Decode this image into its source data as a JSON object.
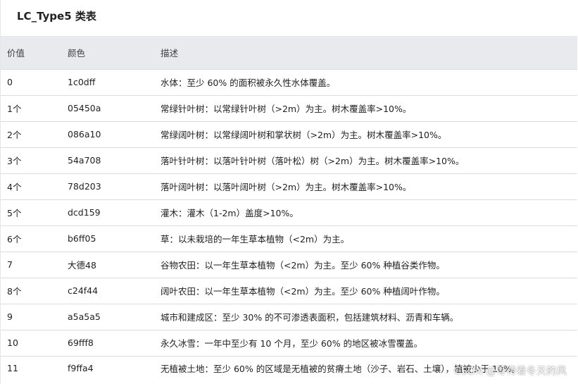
{
  "title": "LC_Type5 类表",
  "headers": [
    "价值",
    "颜色",
    "描述"
  ],
  "rows": [
    [
      "0",
      "1c0dff",
      "水体：至少 60% 的面积被永久性水体覆盖。"
    ],
    [
      "1个",
      "05450a",
      "常绿针叶树：以常绿针叶树（>2m）为主。树木覆盖率>10%。"
    ],
    [
      "2个",
      "086a10",
      "常绿阔叶树：以常绿阔叶树和掌状树（>2m）为主。树木覆盖率>10%。"
    ],
    [
      "3个",
      "54a708",
      "落叶针叶树：以落叶针叶树（落叶松）树（>2m）为主。树木覆盖率>10%。"
    ],
    [
      "4个",
      "78d203",
      "落叶阔叶树：以落叶阔叶树（>2m）为主。树木覆盖率>10%。"
    ],
    [
      "5个",
      "dcd159",
      "灌木：灌木（1-2m）盖度>10%。"
    ],
    [
      "6个",
      "b6ff05",
      "草：以未栽培的一年生草本植物（<2m）为主。"
    ],
    [
      "7",
      "大德48",
      "谷物农田：以一年生草本植物（<2m）为主。至少 60% 种植谷类作物。"
    ],
    [
      "8个",
      "c24f44",
      "阔叶农田：以一年生草本植物（<2m）为主。至少 60% 种植阔叶作物。"
    ],
    [
      "9",
      "a5a5a5",
      "城市和建成区：至少 30% 的不可渗透表面积，包括建筑材料、沥青和车辆。"
    ],
    [
      "10",
      "69fff8",
      "永久冰雪：一年中至少有 10 个月，至少 60% 的地区被冰雪覆盖。"
    ],
    [
      "11",
      "f9ffa4",
      "无植被土地：至少 60% 的区域是无植被的贫瘠土地（沙子、岩石、土壤），植被少于 10%。"
    ]
  ],
  "watermark": "CSDN @等待着冬天的风",
  "colors": {
    "header_bg": "#e9eaed",
    "border": "#dadce0",
    "text": "#212121"
  }
}
